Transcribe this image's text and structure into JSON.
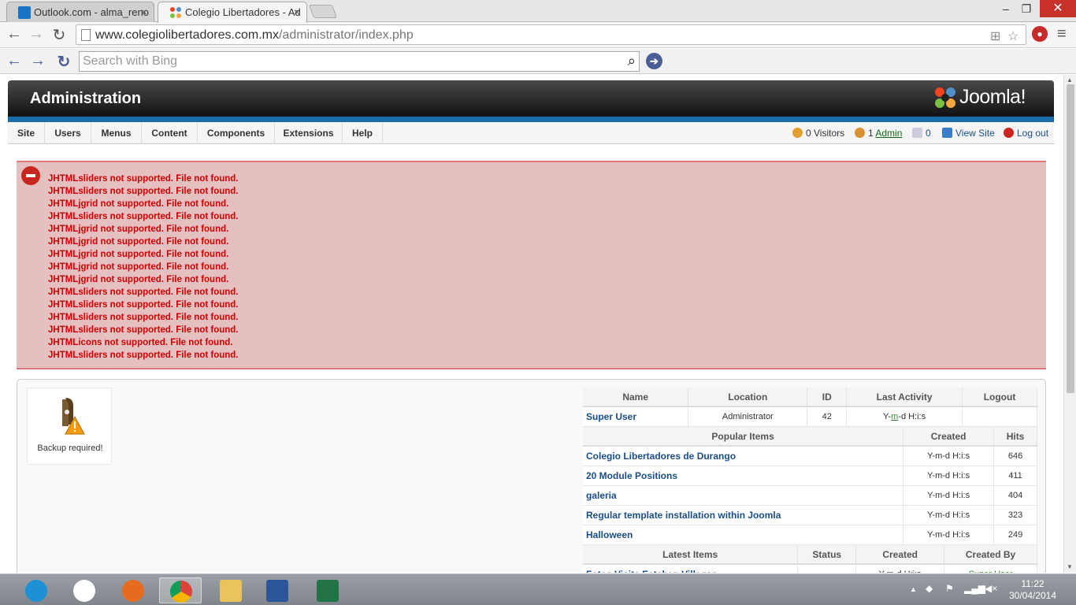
{
  "browser": {
    "tabs": [
      {
        "title": "Outlook.com - alma_reno",
        "icon_color": "#1a73c7"
      },
      {
        "title": "Colegio Libertadores - Ad",
        "icon_color": "#e04f2c"
      }
    ],
    "close_glyph": "×",
    "url_host": "www.colegiolibertadores.com.mx",
    "url_path": "/administrator/index.php",
    "window_controls": {
      "minimize": "–",
      "maximize": "❐",
      "close": "✕"
    }
  },
  "bing": {
    "placeholder": "Search with Bing",
    "go_glyph": "➔"
  },
  "joomla": {
    "header_title": "Administration",
    "logo_text": "Joomla!",
    "menu": [
      "Site",
      "Users",
      "Menus",
      "Content",
      "Components",
      "Extensions",
      "Help"
    ],
    "status": {
      "visitors": "0 Visitors",
      "admins_count": "1",
      "admin_link": "Admin",
      "messages": "0",
      "view_site": "View Site",
      "logout": "Log out"
    },
    "errors": [
      "JHTMLsliders not supported. File not found.",
      "JHTMLsliders not supported. File not found.",
      "JHTMLjgrid not supported. File not found.",
      "JHTMLsliders not supported. File not found.",
      "JHTMLjgrid not supported. File not found.",
      "JHTMLjgrid not supported. File not found.",
      "JHTMLjgrid not supported. File not found.",
      "JHTMLjgrid not supported. File not found.",
      "JHTMLjgrid not supported. File not found.",
      "JHTMLsliders not supported. File not found.",
      "JHTMLsliders not supported. File not found.",
      "JHTMLsliders not supported. File not found.",
      "JHTMLsliders not supported. File not found.",
      "JHTMLicons not supported. File not found.",
      "JHTMLsliders not supported. File not found."
    ],
    "quickicon_label": "Backup required!",
    "logged_table": {
      "headers": [
        "Name",
        "Location",
        "ID",
        "Last Activity",
        "Logout"
      ],
      "row": {
        "name": "Super User",
        "location": "Administrator",
        "id": "42",
        "activity_a": "Y-",
        "activity_m": "m",
        "activity_b": "-d H:i:s",
        "logout": ""
      }
    },
    "popular_table": {
      "headers": [
        "Popular Items",
        "Created",
        "Hits"
      ],
      "rows": [
        {
          "title": "Colegio Libertadores de Durango",
          "created": "Y-m-d H:i:s",
          "hits": "646"
        },
        {
          "title": "20 Module Positions",
          "created": "Y-m-d H:i:s",
          "hits": "411"
        },
        {
          "title": "galeria",
          "created": "Y-m-d H:i:s",
          "hits": "404"
        },
        {
          "title": "Regular template installation within Joomla",
          "created": "Y-m-d H:i:s",
          "hits": "323"
        },
        {
          "title": "Halloween",
          "created": "Y-m-d H:i:s",
          "hits": "249"
        }
      ]
    },
    "latest_table": {
      "headers": [
        "Latest Items",
        "Status",
        "Created",
        "Created By"
      ],
      "row": {
        "title": "Fotos Visita Esteban Villegas",
        "status": "",
        "created": "Y-m-d H:i:s",
        "by": "Super User"
      }
    }
  },
  "taskbar": {
    "time": "11:22",
    "date": "30/04/2014"
  }
}
